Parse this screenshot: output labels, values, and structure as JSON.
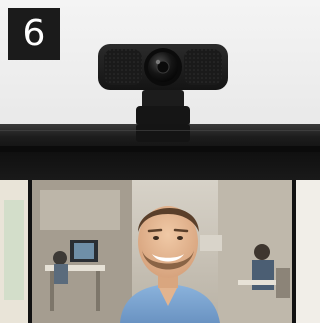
{
  "step": {
    "number": "6"
  },
  "scene": {
    "webcam": "webcam-icon",
    "person": "smiling-man-photo",
    "monitor": "monitor-edge"
  },
  "colors": {
    "badge_bg": "#1b1b1b",
    "badge_text": "#ffffff",
    "webcam_body": "#1f1f1f",
    "monitor_bar": "#1d1d1d",
    "shirt_blue": "#7fa8d3"
  }
}
